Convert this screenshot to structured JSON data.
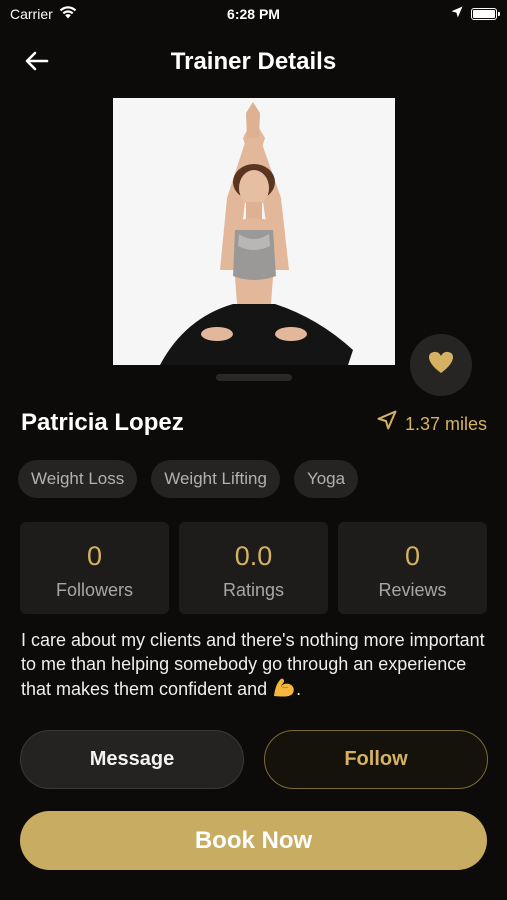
{
  "status_bar": {
    "carrier": "Carrier",
    "time": "6:28 PM"
  },
  "header": {
    "title": "Trainer Details",
    "back_icon": "arrow-left-icon"
  },
  "photo": {
    "subject": "trainer-yoga-photo"
  },
  "trainer": {
    "name": "Patricia Lopez",
    "distance": "1.37 miles"
  },
  "tags": [
    "Weight Loss",
    "Weight Lifting",
    "Yoga"
  ],
  "stats": [
    {
      "value": "0",
      "label": "Followers"
    },
    {
      "value": "0.0",
      "label": "Ratings"
    },
    {
      "value": "0",
      "label": "Reviews"
    }
  ],
  "bio": {
    "text": "I care about my clients and there's nothing more important to me than helping somebody go through an experience that makes them confident and",
    "emoji": "💪",
    "end": "."
  },
  "actions": {
    "message_label": "Message",
    "follow_label": "Follow",
    "book_label": "Book Now"
  },
  "colors": {
    "accent": "#d4b261",
    "book_button": "#c7ac62",
    "background": "#0c0b0a",
    "card": "#1d1c1b"
  }
}
